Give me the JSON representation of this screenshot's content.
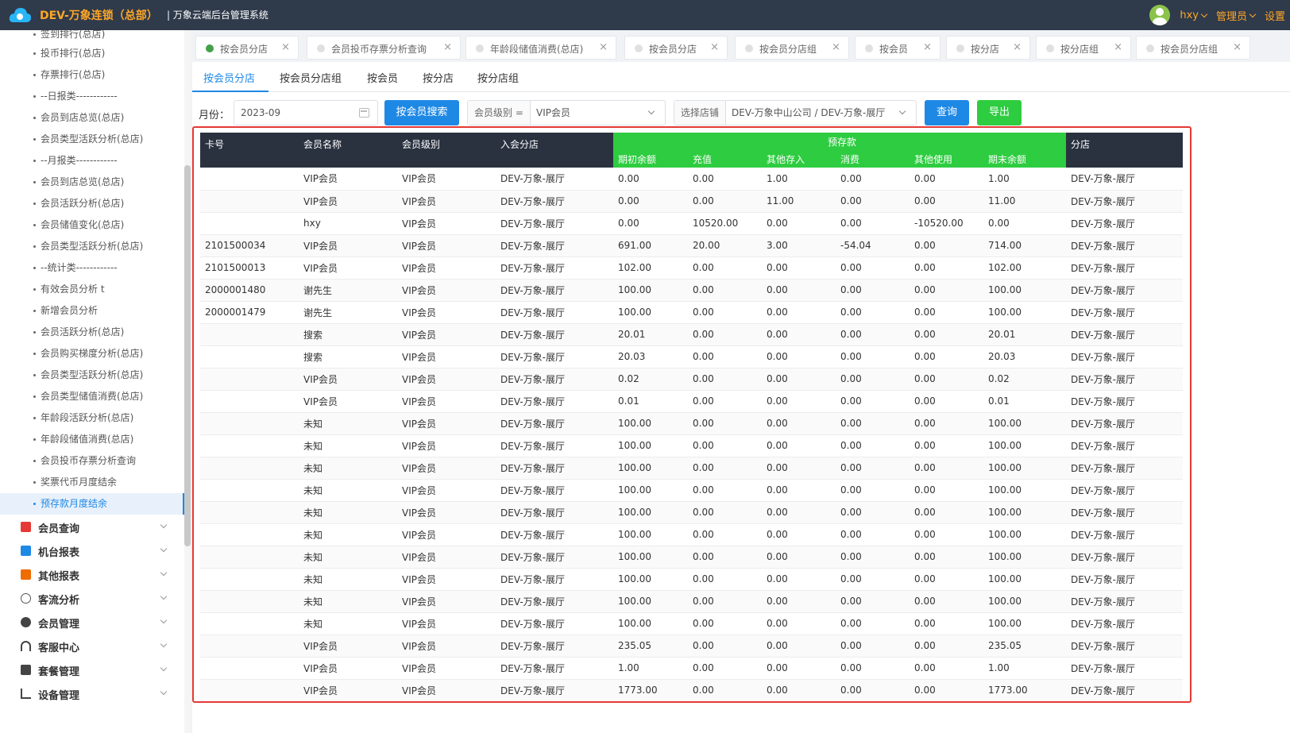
{
  "header": {
    "brand": "DEV-万象连锁（总部）",
    "system": "| 万象云端后台管理系统",
    "user": "hxy",
    "role": "管理员",
    "settings": "设置"
  },
  "sidebar": {
    "sub_items": [
      "签到排行(总店)",
      "投币排行(总店)",
      "存票排行(总店)",
      "--日报类------------",
      "会员到店总览(总店)",
      "会员类型活跃分析(总店)",
      "--月报类------------",
      "会员到店总览(总店)",
      "会员活跃分析(总店)",
      "会员储值变化(总店)",
      "会员类型活跃分析(总店)",
      "--统计类------------",
      "有效会员分析 t",
      "新增会员分析",
      "会员活跃分析(总店)",
      "会员购买梯度分析(总店)",
      "会员类型活跃分析(总店)",
      "会员类型储值消费(总店)",
      "年龄段活跃分析(总店)",
      "年龄段储值消费(总店)",
      "会员投币存票分析查询",
      "奖票代币月度结余",
      "预存款月度结余"
    ],
    "groups": [
      "会员查询",
      "机台报表",
      "其他报表",
      "客流分析",
      "会员管理",
      "客服中心",
      "套餐管理",
      "设备管理"
    ]
  },
  "tabs": [
    "按会员分店",
    "会员投币存票分析查询",
    "年龄段储值消费(总店)",
    "按会员分店",
    "按会员分店组",
    "按会员",
    "按分店",
    "按分店组",
    "按会员分店组"
  ],
  "subtabs": [
    "按会员分店",
    "按会员分店组",
    "按会员",
    "按分店",
    "按分店组"
  ],
  "filters": {
    "month_label": "月份：",
    "month_value": "2023-09",
    "member_search": "按会员搜索",
    "level_prefix": "会员级别 =",
    "level_value": "VIP会员",
    "store_prefix": "选择店铺",
    "store_value": "DEV-万象中山公司 / DEV-万象-展厅",
    "query": "查询",
    "export": "导出"
  },
  "table": {
    "headers": {
      "card": "卡号",
      "name": "会员名称",
      "level": "会员级别",
      "store": "入会分店",
      "group": "预存款",
      "opening": "期初余额",
      "recharge": "充值",
      "other_in": "其他存入",
      "consume": "消费",
      "other_use": "其他使用",
      "closing": "期末余额",
      "branch": "分店"
    },
    "rows": [
      [
        "",
        "VIP会员",
        "VIP会员",
        "DEV-万象-展厅",
        "0.00",
        "0.00",
        "1.00",
        "0.00",
        "0.00",
        "1.00",
        "DEV-万象-展厅"
      ],
      [
        "",
        "VIP会员",
        "VIP会员",
        "DEV-万象-展厅",
        "0.00",
        "0.00",
        "11.00",
        "0.00",
        "0.00",
        "11.00",
        "DEV-万象-展厅"
      ],
      [
        "",
        "hxy",
        "VIP会员",
        "DEV-万象-展厅",
        "0.00",
        "10520.00",
        "0.00",
        "0.00",
        "-10520.00",
        "0.00",
        "DEV-万象-展厅"
      ],
      [
        "2101500034",
        "VIP会员",
        "VIP会员",
        "DEV-万象-展厅",
        "691.00",
        "20.00",
        "3.00",
        "-54.04",
        "0.00",
        "714.00",
        "DEV-万象-展厅"
      ],
      [
        "2101500013",
        "VIP会员",
        "VIP会员",
        "DEV-万象-展厅",
        "102.00",
        "0.00",
        "0.00",
        "0.00",
        "0.00",
        "102.00",
        "DEV-万象-展厅"
      ],
      [
        "2000001480",
        "谢先生",
        "VIP会员",
        "DEV-万象-展厅",
        "100.00",
        "0.00",
        "0.00",
        "0.00",
        "0.00",
        "100.00",
        "DEV-万象-展厅"
      ],
      [
        "2000001479",
        "谢先生",
        "VIP会员",
        "DEV-万象-展厅",
        "100.00",
        "0.00",
        "0.00",
        "0.00",
        "0.00",
        "100.00",
        "DEV-万象-展厅"
      ],
      [
        "",
        "搜索",
        "VIP会员",
        "DEV-万象-展厅",
        "20.01",
        "0.00",
        "0.00",
        "0.00",
        "0.00",
        "20.01",
        "DEV-万象-展厅"
      ],
      [
        "",
        "搜索",
        "VIP会员",
        "DEV-万象-展厅",
        "20.03",
        "0.00",
        "0.00",
        "0.00",
        "0.00",
        "20.03",
        "DEV-万象-展厅"
      ],
      [
        "",
        "VIP会员",
        "VIP会员",
        "DEV-万象-展厅",
        "0.02",
        "0.00",
        "0.00",
        "0.00",
        "0.00",
        "0.02",
        "DEV-万象-展厅"
      ],
      [
        "",
        "VIP会员",
        "VIP会员",
        "DEV-万象-展厅",
        "0.01",
        "0.00",
        "0.00",
        "0.00",
        "0.00",
        "0.01",
        "DEV-万象-展厅"
      ],
      [
        "",
        "未知",
        "VIP会员",
        "DEV-万象-展厅",
        "100.00",
        "0.00",
        "0.00",
        "0.00",
        "0.00",
        "100.00",
        "DEV-万象-展厅"
      ],
      [
        "",
        "未知",
        "VIP会员",
        "DEV-万象-展厅",
        "100.00",
        "0.00",
        "0.00",
        "0.00",
        "0.00",
        "100.00",
        "DEV-万象-展厅"
      ],
      [
        "",
        "未知",
        "VIP会员",
        "DEV-万象-展厅",
        "100.00",
        "0.00",
        "0.00",
        "0.00",
        "0.00",
        "100.00",
        "DEV-万象-展厅"
      ],
      [
        "",
        "未知",
        "VIP会员",
        "DEV-万象-展厅",
        "100.00",
        "0.00",
        "0.00",
        "0.00",
        "0.00",
        "100.00",
        "DEV-万象-展厅"
      ],
      [
        "",
        "未知",
        "VIP会员",
        "DEV-万象-展厅",
        "100.00",
        "0.00",
        "0.00",
        "0.00",
        "0.00",
        "100.00",
        "DEV-万象-展厅"
      ],
      [
        "",
        "未知",
        "VIP会员",
        "DEV-万象-展厅",
        "100.00",
        "0.00",
        "0.00",
        "0.00",
        "0.00",
        "100.00",
        "DEV-万象-展厅"
      ],
      [
        "",
        "未知",
        "VIP会员",
        "DEV-万象-展厅",
        "100.00",
        "0.00",
        "0.00",
        "0.00",
        "0.00",
        "100.00",
        "DEV-万象-展厅"
      ],
      [
        "",
        "未知",
        "VIP会员",
        "DEV-万象-展厅",
        "100.00",
        "0.00",
        "0.00",
        "0.00",
        "0.00",
        "100.00",
        "DEV-万象-展厅"
      ],
      [
        "",
        "未知",
        "VIP会员",
        "DEV-万象-展厅",
        "100.00",
        "0.00",
        "0.00",
        "0.00",
        "0.00",
        "100.00",
        "DEV-万象-展厅"
      ],
      [
        "",
        "未知",
        "VIP会员",
        "DEV-万象-展厅",
        "100.00",
        "0.00",
        "0.00",
        "0.00",
        "0.00",
        "100.00",
        "DEV-万象-展厅"
      ],
      [
        "",
        "VIP会员",
        "VIP会员",
        "DEV-万象-展厅",
        "235.05",
        "0.00",
        "0.00",
        "0.00",
        "0.00",
        "235.05",
        "DEV-万象-展厅"
      ],
      [
        "",
        "VIP会员",
        "VIP会员",
        "DEV-万象-展厅",
        "1.00",
        "0.00",
        "0.00",
        "0.00",
        "0.00",
        "1.00",
        "DEV-万象-展厅"
      ],
      [
        "",
        "VIP会员",
        "VIP会员",
        "DEV-万象-展厅",
        "1773.00",
        "0.00",
        "0.00",
        "0.00",
        "0.00",
        "1773.00",
        "DEV-万象-展厅"
      ]
    ]
  },
  "colors": {
    "header_bg": "#2f3a4b",
    "brand": "#ffa726",
    "primary": "#1e88e5",
    "success": "#2ecc40",
    "highlight": "#e53935"
  }
}
